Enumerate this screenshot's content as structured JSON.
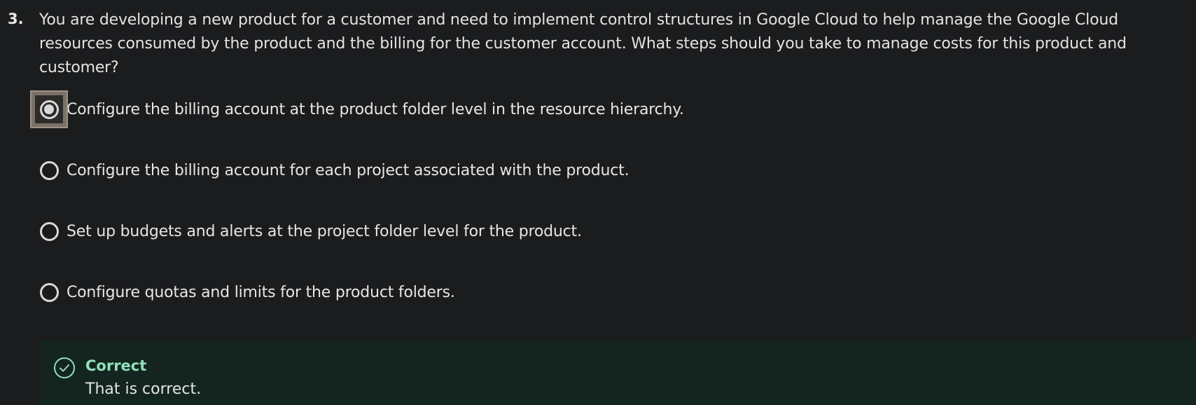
{
  "question": {
    "number": "3.",
    "text": "You are developing a new product for a customer and need to implement control structures in Google Cloud to help manage the Google Cloud resources consumed by the product and the billing for the customer account. What steps should you take to manage costs for this product and customer?"
  },
  "options": [
    {
      "label": "Configure the billing account at the product folder level in the resource hierarchy.",
      "selected": true,
      "icon": "radio-selected-icon"
    },
    {
      "label": "Configure the billing account for each project associated with the product.",
      "selected": false,
      "icon": "radio-empty-icon"
    },
    {
      "label": "Set up budgets and alerts at the project folder level for the product.",
      "selected": false,
      "icon": "radio-empty-icon"
    },
    {
      "label": "Configure quotas and limits for the product folders.",
      "selected": false,
      "icon": "radio-empty-icon"
    }
  ],
  "feedback": {
    "icon": "check-circle-icon",
    "title": "Correct",
    "text": "That is correct.",
    "accent_color": "#8fe0bb",
    "background_color": "#14251f"
  }
}
